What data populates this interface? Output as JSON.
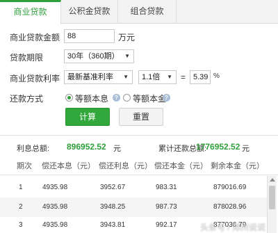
{
  "tabs": [
    {
      "label": "商业贷款",
      "active": true
    },
    {
      "label": "公积金贷款",
      "active": false
    },
    {
      "label": "组合贷款",
      "active": false
    }
  ],
  "form": {
    "amount_label": "商业贷款金额",
    "amount_value": "88",
    "amount_unit": "万元",
    "term_label": "贷款期限",
    "term_value": "30年（360期）",
    "rate_label": "商业贷款利率",
    "rate_type_value": "最新基准利率",
    "rate_multiplier_value": "1.1倍",
    "equals_sign": "=",
    "rate_value": "5.39",
    "rate_unit": "%",
    "method_label": "还款方式",
    "method_options": [
      {
        "label": "等额本息",
        "selected": true
      },
      {
        "label": "等额本金",
        "selected": false
      }
    ]
  },
  "buttons": {
    "calculate": "计算",
    "reset": "重置"
  },
  "summary": {
    "interest_label": "利息总额:",
    "interest_value": "896952.52",
    "interest_unit": "元",
    "total_label": "累计还款总额:",
    "total_value": "1776952.52",
    "total_unit": "元"
  },
  "table": {
    "columns": [
      "期次",
      "偿还本息（元）",
      "偿还利息（元）",
      "偿还本金（元）",
      "剩余本金（元）"
    ],
    "rows": [
      [
        "1",
        "4935.98",
        "3952.67",
        "983.31",
        "879016.69"
      ],
      [
        "2",
        "4935.98",
        "3948.25",
        "987.73",
        "878028.96"
      ],
      [
        "3",
        "4935.98",
        "3943.81",
        "992.17",
        "877036.79"
      ]
    ]
  },
  "watermark": "头条号 / 郑州说说",
  "colors": {
    "accent": "#2e9f3a",
    "button_primary": "#32a83c",
    "help_icon": "#a9bfd8"
  }
}
